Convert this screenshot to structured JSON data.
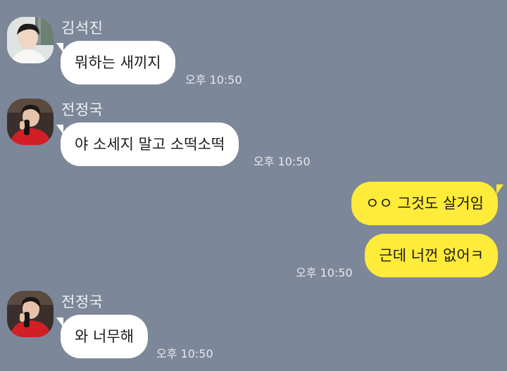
{
  "messages": [
    {
      "sender": "김석진",
      "text": "뭐하는 새끼지",
      "time": "오후 10:50",
      "direction": "incoming"
    },
    {
      "sender": "전정국",
      "text": "야 소세지 말고 소떡소떡",
      "time": "오후 10:50",
      "direction": "incoming"
    },
    {
      "text": "ㅇㅇ 그것도 살거임",
      "direction": "outgoing"
    },
    {
      "text": "근데 너껀 없어ㅋ",
      "time": "오후 10:50",
      "direction": "outgoing"
    },
    {
      "sender": "전정국",
      "text": "와 너무해",
      "time": "오후 10:50",
      "direction": "incoming"
    }
  ],
  "colors": {
    "background": "#7c8799",
    "incoming_bubble": "#ffffff",
    "outgoing_bubble": "#ffeb3a",
    "text": "#1b1b1b",
    "meta_text": "#e6e9ee"
  }
}
